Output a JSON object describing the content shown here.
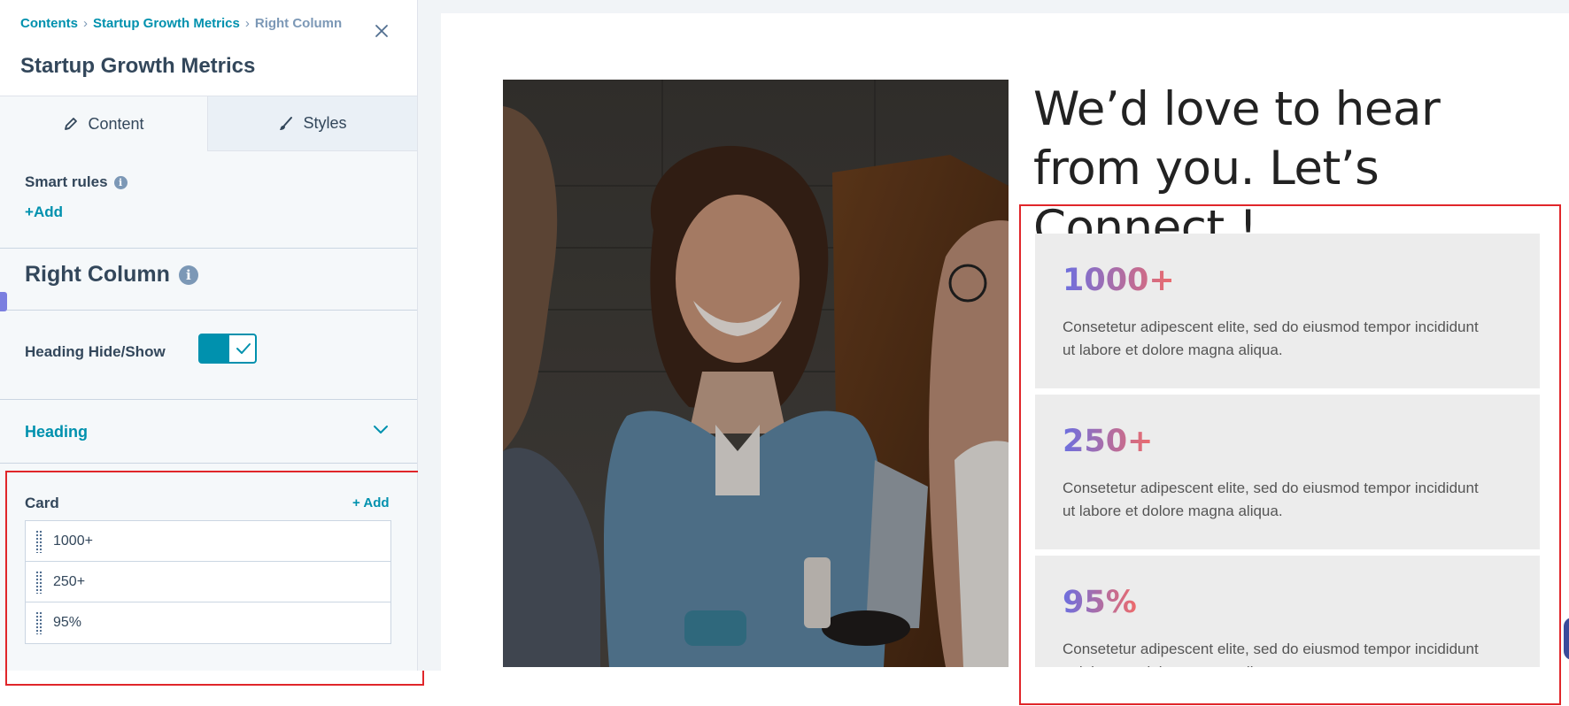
{
  "breadcrumb": {
    "items": [
      "Contents",
      "Startup Growth Metrics"
    ],
    "current": "Right Column"
  },
  "panel": {
    "title": "Startup Growth Metrics",
    "tabs": [
      {
        "label": "Content",
        "icon": "pencil-icon",
        "active": true
      },
      {
        "label": "Styles",
        "icon": "brush-icon",
        "active": false
      }
    ],
    "smart_rules": {
      "label": "Smart rules",
      "add_label": "Add"
    },
    "section_title": "Right Column",
    "toggle": {
      "label": "Heading Hide/Show",
      "checked": true
    },
    "heading_accordion": {
      "label": "Heading"
    },
    "card": {
      "label": "Card",
      "add_label": "+ Add",
      "items": [
        "1000+",
        "250+",
        "95%"
      ]
    }
  },
  "preview": {
    "heading": "We’d love to hear from you. Let’s Connect !",
    "cards": [
      {
        "number": "1000+",
        "description": "Consetetur adipescent elite, sed do eiusmod tempor incididunt ut labore et dolore magna aliqua."
      },
      {
        "number": "250+",
        "description": "Consetetur adipescent elite, sed do eiusmod tempor incididunt ut labore et dolore magna aliqua."
      },
      {
        "number": "95%",
        "description": "Consetetur adipescent elite, sed do eiusmod tempor incididunt ut labore et dolore magna aliqua."
      }
    ]
  },
  "colors": {
    "accent": "#0091ae",
    "text": "#33475b",
    "highlight": "#e0262a",
    "gradient_start": "#6c6fe0",
    "gradient_end": "#ee6b6b"
  }
}
